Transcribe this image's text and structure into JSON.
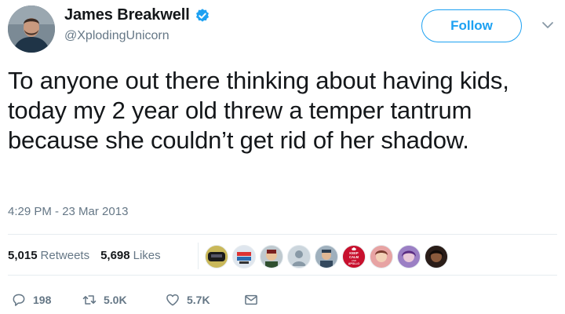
{
  "author": {
    "name": "James Breakwell",
    "handle": "@XplodingUnicorn",
    "verified_icon": "verified-badge-icon"
  },
  "follow_button": {
    "label": "Follow"
  },
  "menu": {
    "icon": "chevron-down-icon"
  },
  "tweet": {
    "text": "To anyone out there thinking about having kids, today my 2 year old threw a temper tantrum because she couldn’t get rid of her shadow.",
    "timestamp": "4:29 PM - 23 Mar 2013"
  },
  "stats": {
    "retweets_count": "5,015",
    "retweets_label": "Retweets",
    "likes_count": "5,698",
    "likes_label": "Likes"
  },
  "likers": {
    "count_shown": 10,
    "keep_calm_badge": [
      "KEEP",
      "CALM",
      "AND",
      "APOLLO"
    ]
  },
  "actions": {
    "reply_count": "198",
    "retweet_count": "5.0K",
    "like_count": "5.7K"
  },
  "colors": {
    "accent": "#1da1f2",
    "text_primary": "#14171a",
    "text_secondary": "#657786",
    "divider": "#e6ecf0"
  }
}
